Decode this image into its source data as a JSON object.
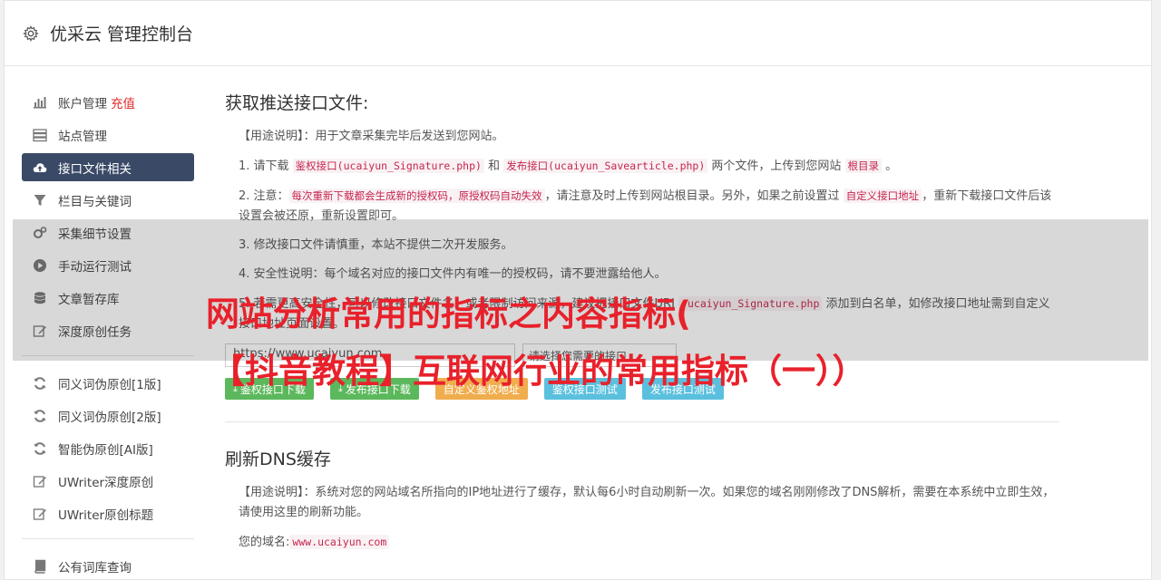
{
  "app": {
    "title": "优采云 管理控制台"
  },
  "sidebar": {
    "group1": [
      {
        "label": "账户管理",
        "badge": "充值",
        "icon": "bar-chart-icon"
      },
      {
        "label": "站点管理",
        "icon": "server-icon"
      },
      {
        "label": "接口文件相关",
        "icon": "cloud-upload-icon",
        "active": true
      },
      {
        "label": "栏目与关键词",
        "icon": "filter-icon"
      },
      {
        "label": "采集细节设置",
        "icon": "gears-icon"
      },
      {
        "label": "手动运行测试",
        "icon": "play-icon"
      },
      {
        "label": "文章暂存库",
        "icon": "database-icon"
      },
      {
        "label": "深度原创任务",
        "icon": "edit-icon"
      }
    ],
    "group2": [
      {
        "label": "同义词伪原创[1版]",
        "icon": "refresh-icon"
      },
      {
        "label": "同义词伪原创[2版]",
        "icon": "refresh-icon"
      },
      {
        "label": "智能伪原创[AI版]",
        "icon": "refresh-icon"
      },
      {
        "label": "UWriter深度原创",
        "icon": "edit-icon"
      },
      {
        "label": "UWriter原创标题",
        "icon": "edit-icon"
      }
    ],
    "group3": [
      {
        "label": "公有词库查询",
        "icon": "book-icon"
      }
    ]
  },
  "section1": {
    "title": "获取推送接口文件:",
    "usage": "【用途说明】：用于文章采集完毕后发送到您网站。",
    "step1": {
      "pre": "1. 请下载 ",
      "code1": "鉴权接口(ucaiyun_Signature.php)",
      "mid1": " 和 ",
      "code2": "发布接口(ucaiyun_Savearticle.php)",
      "mid2": " 两个文件，上传到您网站 ",
      "code3": "根目录",
      "post": " 。"
    },
    "step2": {
      "pre": "2. 注意：",
      "code1": "每次重新下载都会生成新的授权码，原授权码自动失效",
      "mid": "，请注意及时上传到网站根目录。另外，如果之前设置过 ",
      "code2": "自定义接口地址",
      "post": "，重新下载接口文件后该设置会被还原，重新设置即可。"
    },
    "step3": "3. 修改接口文件请慎重，本站不提供二次开发服务。",
    "step4": "4. 安全性说明：每个域名对应的接口文件内有唯一的授权码，请不要泄露给他人。",
    "step5": {
      "pre": "5. 若需更高安全性，可以修改接口文件名，或者限制访问来源，建议把接口文件URI ",
      "code1": "/ucaiyun_Signature.php",
      "post": " 添加到白名单，如修改接口地址需到自定义接口地址页面设置。"
    },
    "input_value": "https://www.ucaiyun.com",
    "select_value": "请选择您需要的接口",
    "buttons": [
      "鉴权接口下载",
      "发布接口下载",
      "自定义鉴权地址",
      "鉴权接口测试",
      "发布接口测试"
    ]
  },
  "section2": {
    "title": "刷新DNS缓存",
    "usage": "【用途说明】：系统对您的网站域名所指向的IP地址进行了缓存，默认每6小时自动刷新一次。如果您的域名刚刚修改了DNS解析，需要在本系统中立即生效，请使用这里的刷新功能。",
    "domain_label": "您的域名:",
    "domain_value": "www.ucaiyun.com"
  },
  "overlay": {
    "line1": "网站分析常用的指标之内容指标(",
    "line2": "【抖音教程】互联网行业的常用指标（一））"
  },
  "colors": {
    "active_nav": "#3a4a66",
    "green": "#5cb85c",
    "orange": "#f0ad4e",
    "blue": "#5bc0de",
    "overlay_text": "#e8212b"
  }
}
